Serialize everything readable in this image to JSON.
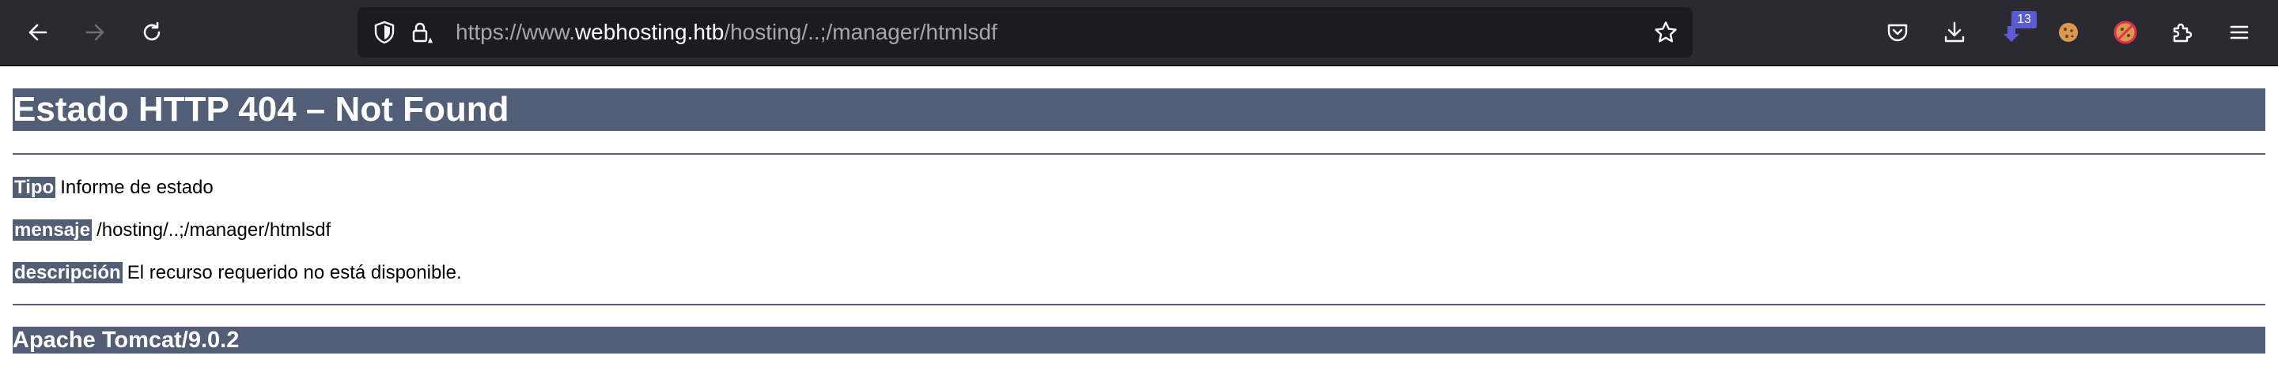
{
  "browser": {
    "url": {
      "prefix": "https://www.",
      "host": "webhosting.htb",
      "path": "/hosting/..;/manager/htmlsdf"
    },
    "extension_badge_count": "13",
    "icons": {
      "back": "arrow-left-icon",
      "forward": "arrow-right-icon",
      "reload": "reload-icon",
      "tracking_protection": "shield-icon",
      "site_info": "lock-warning-icon",
      "bookmark": "star-icon",
      "pocket": "pocket-icon",
      "downloads": "download-icon",
      "extension_1": "extension-badge-icon",
      "extension_2": "cookie-icon",
      "extension_3": "cookie-blocked-icon",
      "extensions": "puzzle-icon",
      "menu": "hamburger-menu-icon"
    },
    "colors": {
      "toolbar": "#2b2a33",
      "urlbar": "#1c1b22",
      "text_dim": "#a7a6ae",
      "text_bright": "#fbfbfe"
    }
  },
  "page": {
    "heading": "Estado HTTP 404 – Not Found",
    "rows": [
      {
        "label": "Tipo",
        "value": "Informe de estado"
      },
      {
        "label": "mensaje",
        "value": "/hosting/..;/manager/htmlsdf"
      },
      {
        "label": "descripción",
        "value": "El recurso requerido no está disponible."
      }
    ],
    "footer": "Apache Tomcat/9.0.2",
    "colors": {
      "header_bg": "#525d76",
      "header_text": "#ffffff"
    }
  }
}
